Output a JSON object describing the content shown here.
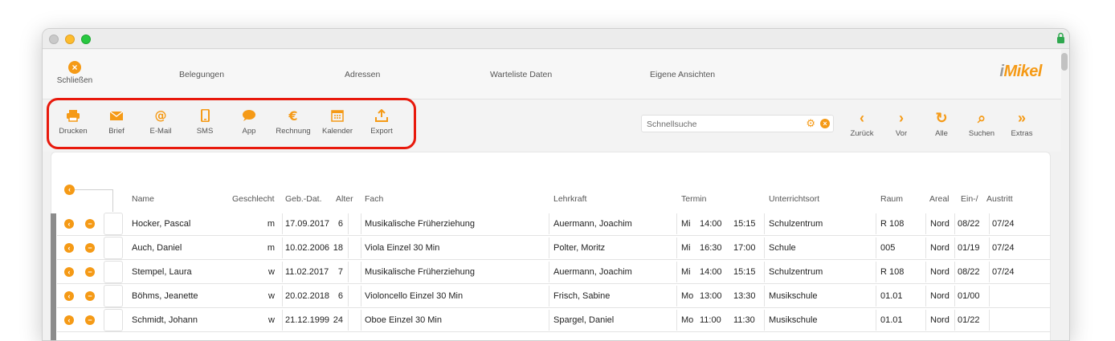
{
  "window": {
    "title": ""
  },
  "nav": {
    "close_label": "Schließen",
    "links": [
      "Belegungen",
      "Adressen",
      "Warteliste Daten",
      "Eigene Ansichten"
    ],
    "logo_i": "i",
    "logo_text": "Mikel"
  },
  "toolbar": {
    "buttons": [
      "Drucken",
      "Brief",
      "E-Mail",
      "SMS",
      "App",
      "Rechnung",
      "Kalender",
      "Export"
    ],
    "search_placeholder": "Schnellsuche",
    "right_buttons": [
      {
        "label": "Zurück",
        "icon": "chevron-left-icon",
        "glyph": "‹"
      },
      {
        "label": "Vor",
        "icon": "chevron-right-icon",
        "glyph": "›"
      },
      {
        "label": "Alle",
        "icon": "refresh-icon",
        "glyph": "↻"
      },
      {
        "label": "Suchen",
        "icon": "search-icon",
        "glyph": "⌕"
      },
      {
        "label": "Extras",
        "icon": "double-chevron-icon",
        "glyph": "»"
      }
    ]
  },
  "table": {
    "headers": [
      "Name",
      "Geschlecht",
      "Geb.-Dat.",
      "Alter",
      "Fach",
      "Lehrkraft",
      "Termin",
      "Unterrichtsort",
      "Raum",
      "Areal",
      "Ein-/",
      "Austritt"
    ],
    "rows": [
      {
        "name": "Hocker, Pascal",
        "sex": "m",
        "dob": "17.09.2017",
        "age": "6",
        "subject": "Musikalische Früherziehung",
        "teacher": "Auermann, Joachim",
        "day": "Mi",
        "start": "14:00",
        "end": "15:15",
        "place": "Schulzentrum",
        "room": "R 108",
        "area": "Nord",
        "entry": "08/22",
        "exit": "07/24"
      },
      {
        "name": "Auch, Daniel",
        "sex": "m",
        "dob": "10.02.2006",
        "age": "18",
        "subject": "Viola Einzel 30 Min",
        "teacher": "Polter, Moritz",
        "day": "Mi",
        "start": "16:30",
        "end": "17:00",
        "place": "Schule",
        "room": "005",
        "area": "Nord",
        "entry": "01/19",
        "exit": "07/24"
      },
      {
        "name": "Stempel, Laura",
        "sex": "w",
        "dob": "11.02.2017",
        "age": "7",
        "subject": "Musikalische Früherziehung",
        "teacher": "Auermann, Joachim",
        "day": "Mi",
        "start": "14:00",
        "end": "15:15",
        "place": "Schulzentrum",
        "room": "R 108",
        "area": "Nord",
        "entry": "08/22",
        "exit": "07/24"
      },
      {
        "name": "Böhms, Jeanette",
        "sex": "w",
        "dob": "20.02.2018",
        "age": "6",
        "subject": "Violoncello Einzel 30 Min",
        "teacher": "Frisch, Sabine",
        "day": "Mo",
        "start": "13:00",
        "end": "13:30",
        "place": "Musikschule",
        "room": "01.01",
        "area": "Nord",
        "entry": "01/00",
        "exit": ""
      },
      {
        "name": "Schmidt, Johann",
        "sex": "w",
        "dob": "21.12.1999",
        "age": "24",
        "subject": "Oboe Einzel 30 Min",
        "teacher": "Spargel, Daniel",
        "day": "Mo",
        "start": "11:00",
        "end": "11:30",
        "place": "Musikschule",
        "room": "01.01",
        "area": "Nord",
        "entry": "01/22",
        "exit": ""
      }
    ]
  },
  "colors": {
    "accent": "#f59a16",
    "highlight": "#e8190c"
  }
}
